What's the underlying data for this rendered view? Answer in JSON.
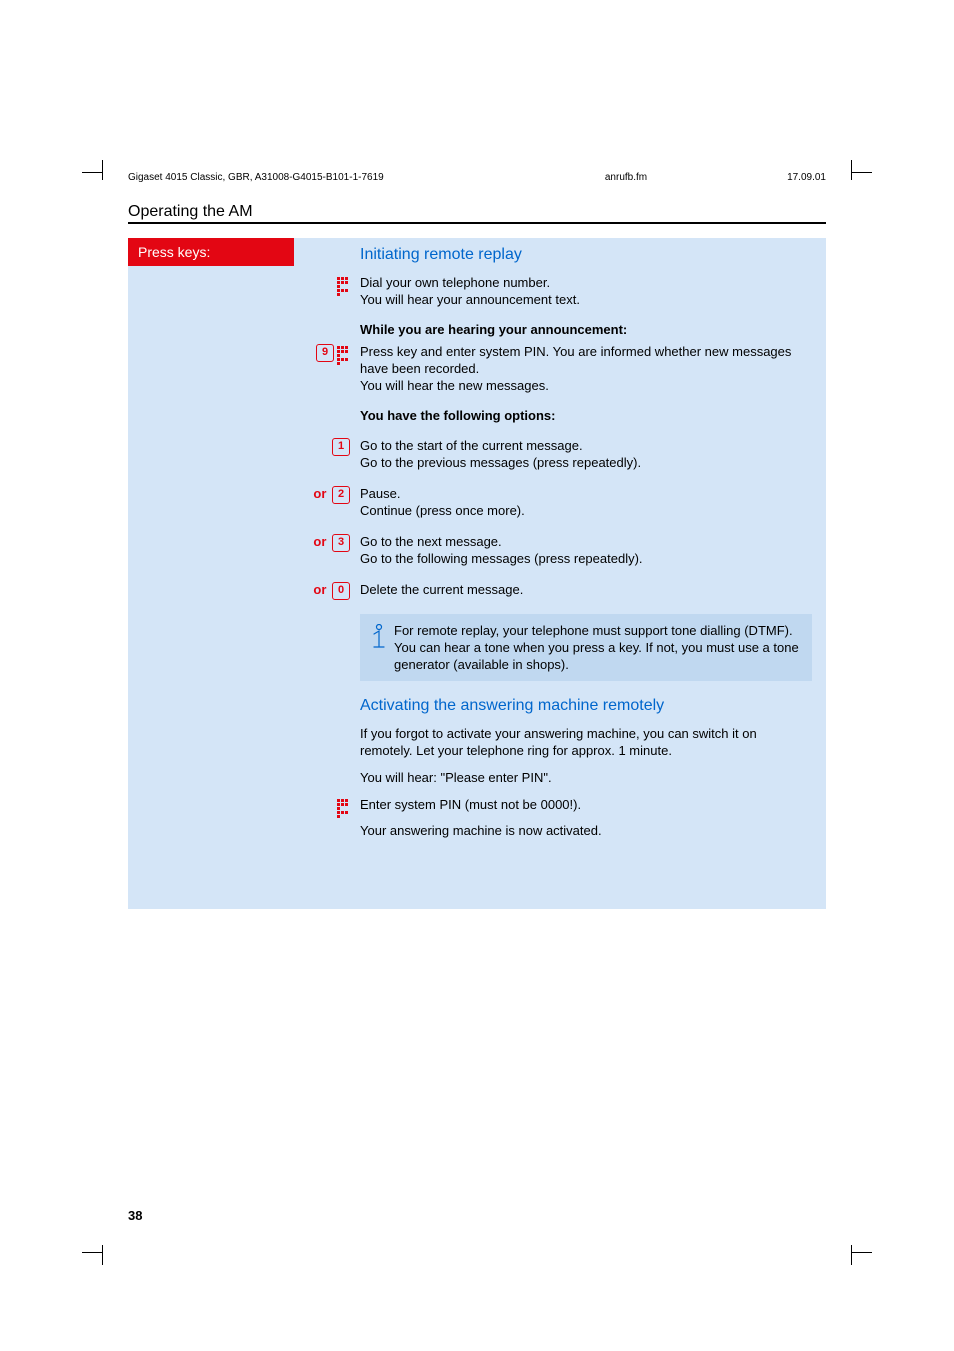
{
  "header": {
    "left": "Gigaset 4015 Classic, GBR, A31008-G4015-B101-1-7619",
    "mid": "anrufb.fm",
    "right": "17.09.01"
  },
  "section_title": "Operating the AM",
  "sidebar_title": "Press keys:",
  "s1": {
    "heading": "Initiating remote replay",
    "dial_text": "Dial your own telephone number.\nYou will hear your announcement text.",
    "while_heading": "While you are hearing your announcement:",
    "key9_text": "Press key and enter system PIN. You are informed whether new messages have been recorded.\nYou will hear the new messages.",
    "options_heading": "You have the following options:",
    "k1": "Go to the start of the current message.\nGo to the previous messages (press repeatedly).",
    "k2": "Pause.\nContinue (press once more).",
    "k3": "Go to the next message.\nGo to the following messages (press repeatedly).",
    "k0": "Delete the current message.",
    "info": "For remote replay, your telephone must support tone dialling (DTMF). You can hear a tone when you press a key. If not, you must use a tone generator (available in shops)."
  },
  "s2": {
    "heading": "Activating the answering machine remotely",
    "p1": "If you forgot to activate your answering machine, you can switch it on remotely. Let your telephone ring for approx. 1 minute.",
    "p2": "You will hear: \"Please enter PIN\".",
    "pin": "Enter system PIN (must not be 0000!).",
    "done": "Your answering machine is now activated."
  },
  "keys": {
    "or": "or",
    "k9": "9",
    "k1": "1",
    "k2": "2",
    "k3": "3",
    "k0": "0"
  },
  "page_number": "38"
}
